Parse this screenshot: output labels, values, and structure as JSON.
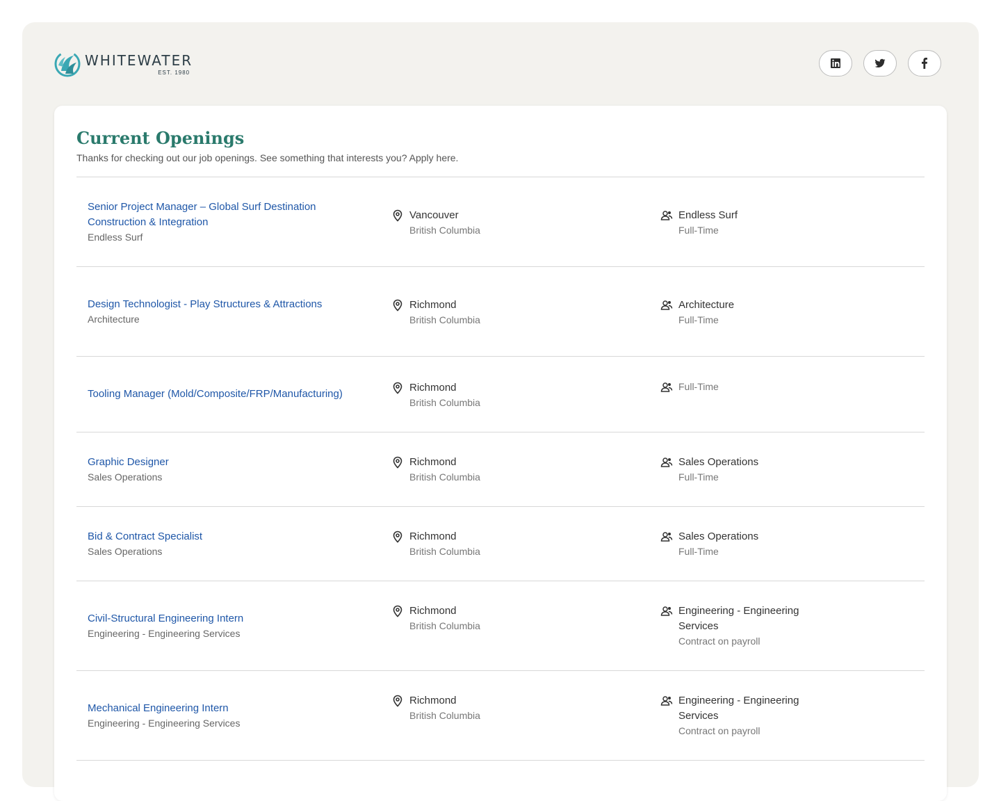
{
  "brand": {
    "name": "WHITEWATER",
    "est": "EST. 1980",
    "colors": {
      "accent": "#2a7a6c",
      "link": "#1f57a8",
      "logo": "#3aa8b4"
    }
  },
  "socials": [
    {
      "icon": "linkedin-icon"
    },
    {
      "icon": "twitter-icon"
    },
    {
      "icon": "facebook-icon"
    }
  ],
  "openings": {
    "title": "Current Openings",
    "subtitle": "Thanks for checking out our job openings. See something that interests you? Apply here.",
    "jobs": [
      {
        "title": "Senior Project Manager – Global Surf Destination Construction & Integration",
        "department": "Endless Surf",
        "city": "Vancouver",
        "region": "British Columbia",
        "team": "Endless Surf",
        "type": "Full-Time"
      },
      {
        "title": "Design Technologist - Play Structures & Attractions",
        "department": "Architecture",
        "city": "Richmond",
        "region": "British Columbia",
        "team": "Architecture",
        "type": "Full-Time"
      },
      {
        "title": "Tooling Manager (Mold/Composite/FRP/Manufacturing)",
        "department": "",
        "city": "Richmond",
        "region": "British Columbia",
        "team": "",
        "type": "Full-Time"
      },
      {
        "title": "Graphic Designer",
        "department": "Sales Operations",
        "city": "Richmond",
        "region": "British Columbia",
        "team": "Sales Operations",
        "type": "Full-Time"
      },
      {
        "title": "Bid & Contract Specialist",
        "department": "Sales Operations",
        "city": "Richmond",
        "region": "British Columbia",
        "team": "Sales Operations",
        "type": "Full-Time"
      },
      {
        "title": "Civil-Structural Engineering Intern",
        "department": "Engineering - Engineering Services",
        "city": "Richmond",
        "region": "British Columbia",
        "team": "Engineering - Engineering Services",
        "type": "Contract on payroll"
      },
      {
        "title": "Mechanical Engineering Intern",
        "department": "Engineering - Engineering Services",
        "city": "Richmond",
        "region": "British Columbia",
        "team": "Engineering - Engineering Services",
        "type": "Contract on payroll"
      }
    ]
  }
}
